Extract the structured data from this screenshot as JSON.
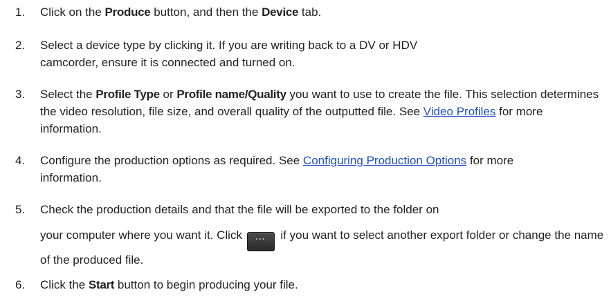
{
  "steps": [
    {
      "number": "1.",
      "t1": "Click on the ",
      "b1": "Produce",
      "t2": " button, and then the ",
      "b2": "Device",
      "t3": " tab."
    },
    {
      "number": "2.",
      "line1": "Select a device type by clicking it. If you are writing back to a DV or HDV",
      "line2": "camcorder, ensure it is connected and turned on."
    },
    {
      "number": "3.",
      "t1": "Select the ",
      "b1": "Profile Type",
      "t2": " or ",
      "b2": "Profile name/Quality",
      "t3": " you want to use to create the file. This selection determines the video resolution, file size, and overall quality of the outputted file. See ",
      "link": "Video Profiles",
      "t4": " for more information."
    },
    {
      "number": "4.",
      "t1": "Configure the production options as required. See ",
      "link": "Configuring Production Options",
      "t2": " for more information."
    },
    {
      "number": "5.",
      "t1": "Check the production details and that the file will be exported to the folder on",
      "t2": "your computer where you want it. Click ",
      "button_label": "···",
      "t3": " if you want to select another export folder or change the name of the produced file."
    },
    {
      "number": "6.",
      "t1": "Click the ",
      "b1": "Start",
      "t2": " button to begin producing your file."
    }
  ]
}
